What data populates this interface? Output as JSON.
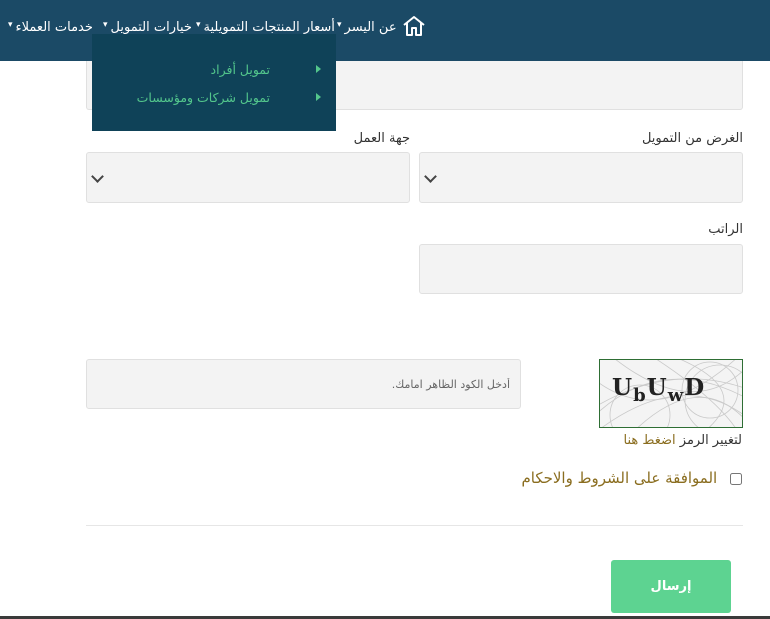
{
  "nav": {
    "items": [
      "خدمات العملاء",
      "خيارات التمويل",
      "أسعار المنتجات التمويلية",
      "عن اليسر"
    ],
    "home_icon": "home-icon",
    "background": "#1b4a66"
  },
  "dropdown": {
    "items": [
      "تمويل أفراد",
      "تمويل شركات ومؤسسات"
    ],
    "background": "#0f4258",
    "text_color": "#53c68c"
  },
  "form": {
    "purpose_label": "الغرض من التمويل",
    "employer_label": "جهة العمل",
    "salary_label": "الراتب",
    "captcha_placeholder": "أدخل الكود الظاهر امامك.",
    "captcha_text": "UbUwD",
    "refresh_text": "لتغيير الرمز",
    "refresh_link": "اضغط هنا",
    "terms_label": "الموافقة على الشروط والاحكام",
    "submit_label": "إرسال"
  },
  "colors": {
    "accent": "#5dd391",
    "link": "#8a6d1f"
  }
}
